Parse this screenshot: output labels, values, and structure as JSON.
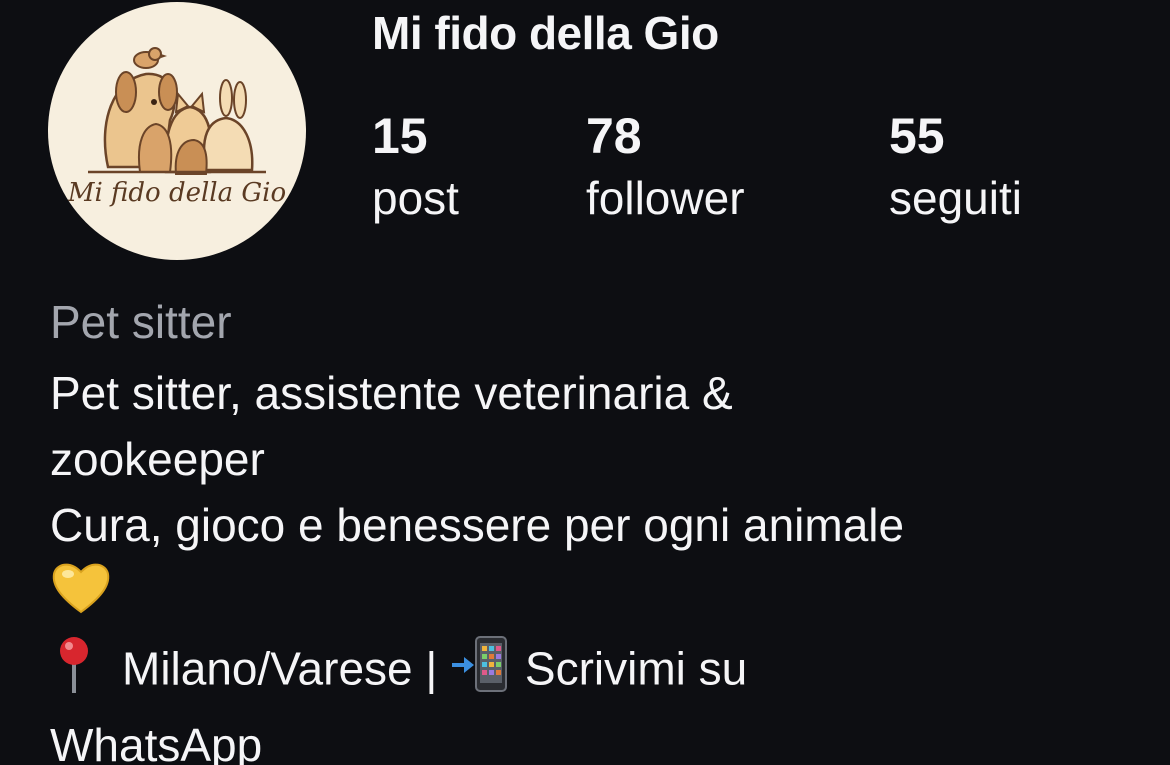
{
  "profile": {
    "username": "Mi fido della Gio",
    "avatar_logo_text": "Mi fido della Gio",
    "stats": {
      "posts": {
        "value": "15",
        "label": "post"
      },
      "followers": {
        "value": "78",
        "label": "follower"
      },
      "following": {
        "value": "55",
        "label": "seguiti"
      }
    },
    "category": "Pet sitter",
    "bio": {
      "line1": "Pet sitter, assistente veterinaria &",
      "line2": "zookeeper",
      "line3": "Cura, gioco e benessere per ogni animale",
      "line4_emoji": "yellow-heart-icon",
      "location": "Milano/Varese |",
      "contact": "Scrivimi su",
      "contact_line2": "WhatsApp"
    }
  },
  "colors": {
    "background": "#0d0e12",
    "text": "#f5f5f7",
    "muted": "#a3a6ae",
    "avatar_bg": "#f7efdf",
    "heart": "#f5c33b",
    "pin": "#d8262e"
  }
}
